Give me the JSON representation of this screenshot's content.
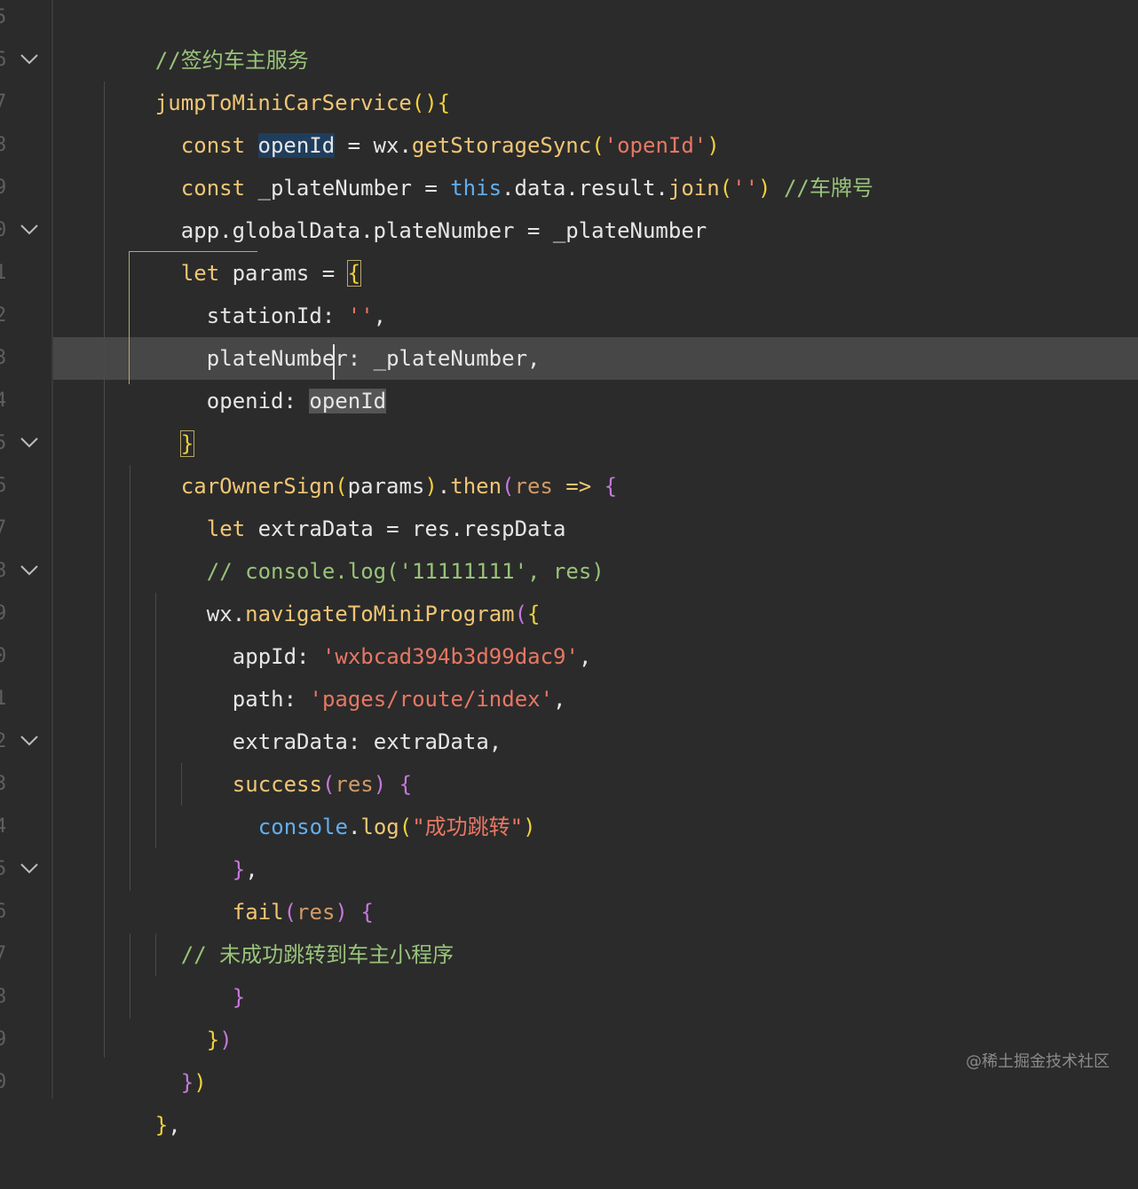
{
  "editor": {
    "line_numbers": [
      "5",
      "6",
      "7",
      "8",
      "9",
      "0",
      "1",
      "2",
      "3",
      "4",
      "5",
      "6",
      "7",
      "8",
      "9",
      "0",
      "1",
      "2",
      "3",
      "4",
      "5",
      "6",
      "7",
      "8",
      "9",
      "0"
    ],
    "lines": {
      "l0_comment": "//签约车主服务",
      "l1_fn": "jumpToMiniCarService",
      "l1_rest": "(){",
      "l2_const": "const",
      "l2_var": "openId",
      "l2_eq": " = wx.",
      "l2_call": "getStorageSync",
      "l2_str": "'openId'",
      "l3_const": "const",
      "l3_var": " _plateNumber = ",
      "l3_this": "this",
      "l3_rest": ".data.result.",
      "l3_join": "join",
      "l3_str": "''",
      "l3_comment": "//车牌号",
      "l4_text": "app.globalData.plateNumber = _plateNumber",
      "l5_let": "let",
      "l5_rest": " params = ",
      "l6_text": "stationId: ",
      "l6_str": "''",
      "l7_text": "plateNumber: _plateNumber,",
      "l8_key": "openid: ",
      "l8_val": "openId",
      "l10_fn": "carOwnerSign",
      "l10_args": "params",
      "l10_then": "then",
      "l10_res": "res",
      "l10_arrow": " => ",
      "l11_let": "let",
      "l11_rest": " extraData = res.respData",
      "l12_comment": "// console.log('11111111', res)",
      "l13_wx": "wx.",
      "l13_fn": "navigateToMiniProgram",
      "l14_key": "appId: ",
      "l14_str": "'wxbcad394b3d99dac9'",
      "l15_key": "path: ",
      "l15_str": "'pages/route/index'",
      "l16_text": "extraData: extraData,",
      "l17_fn": "success",
      "l17_res": "res",
      "l18_console": "console",
      "l18_log": "log",
      "l18_str": "\"成功跳转\"",
      "l20_fn": "fail",
      "l20_res": "res",
      "l21_comment": "// 未成功跳转到车主小程序"
    }
  },
  "watermark": "@稀土掘金技术社区",
  "colors": {
    "background": "#2b2b2b",
    "current_line": "#474747",
    "comment": "#98c379",
    "keyword": "#f0c674",
    "string": "#e87764",
    "brace_purple": "#c678dd",
    "this_blue": "#61afef"
  }
}
